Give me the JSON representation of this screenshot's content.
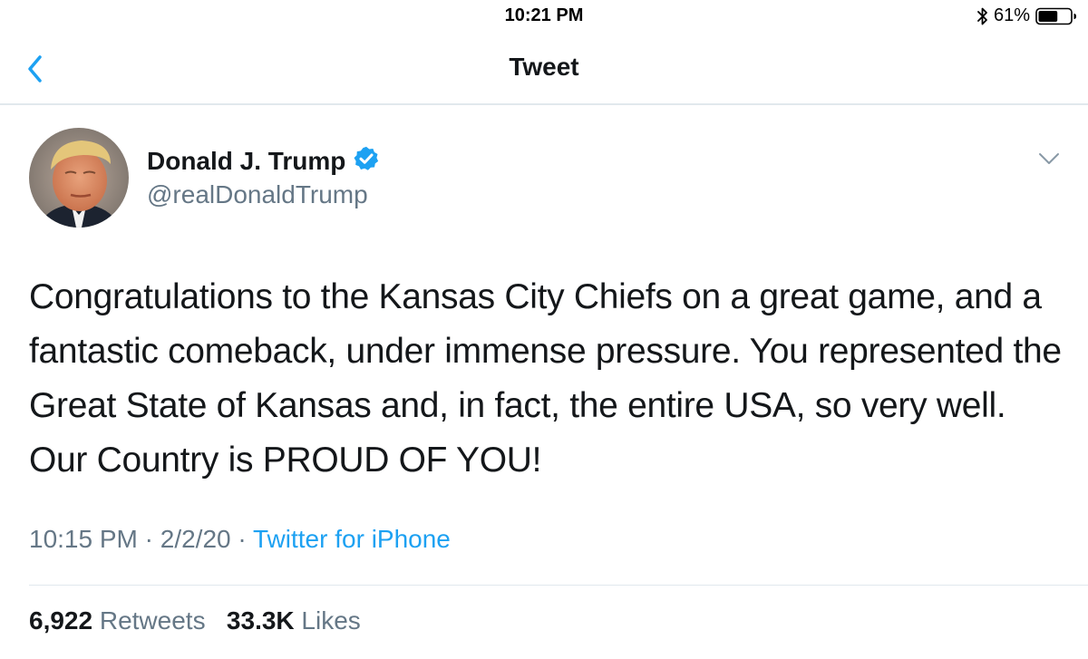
{
  "status_bar": {
    "time": "10:21 PM",
    "battery_percent": "61%",
    "battery_level": 0.61,
    "icons": [
      "bluetooth-icon",
      "battery-icon"
    ]
  },
  "nav": {
    "title": "Tweet",
    "back_icon": "chevron-left-icon"
  },
  "tweet": {
    "author": {
      "display_name": "Donald J. Trump",
      "handle": "@realDonaldTrump",
      "verified": true
    },
    "text": "Congratulations to the Kansas City Chiefs on a great game, and a fantastic comeback, under immense pressure. You represented the Great State of Kansas and, in fact, the entire USA, so very well. Our Country is PROUD OF YOU!",
    "time": "10:15 PM",
    "date": "2/2/20",
    "separator": "·",
    "source": "Twitter for iPhone"
  },
  "stats": {
    "retweets_count": "6,922",
    "retweets_label": "Retweets",
    "likes_count": "33.3K",
    "likes_label": "Likes"
  },
  "colors": {
    "accent": "#1da1f2",
    "verified_badge": "#1da1f2",
    "secondary_text": "#657786",
    "divider": "#e1e8ed"
  }
}
